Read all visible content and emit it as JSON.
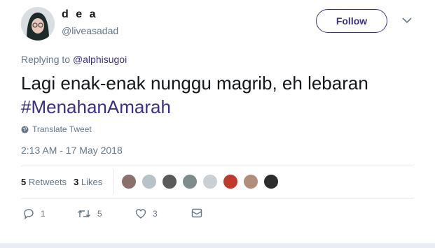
{
  "user": {
    "name": "d e a",
    "handle": "@liveasadad"
  },
  "follow_label": "Follow",
  "reply": {
    "prefix": "Replying to",
    "mention": "@alphisugoi"
  },
  "tweet": {
    "text": "Lagi enak-enak nunggu magrib, eh lebaran",
    "hashtag": "#MenahanAmarah"
  },
  "translate_label": "Translate Tweet",
  "timestamp": "2:13 AM - 17 May 2018",
  "stats": {
    "retweets_count": "5",
    "retweets_label": "Retweets",
    "likes_count": "3",
    "likes_label": "Likes"
  },
  "actions": {
    "reply_count": "1",
    "retweet_count": "5",
    "like_count": "3"
  },
  "colors": {
    "accent": "#3b2f88",
    "muted": "#657786",
    "divider": "#e6ecf0"
  },
  "likers": [
    "avatar",
    "avatar",
    "avatar",
    "avatar",
    "avatar",
    "avatar",
    "avatar",
    "avatar"
  ]
}
